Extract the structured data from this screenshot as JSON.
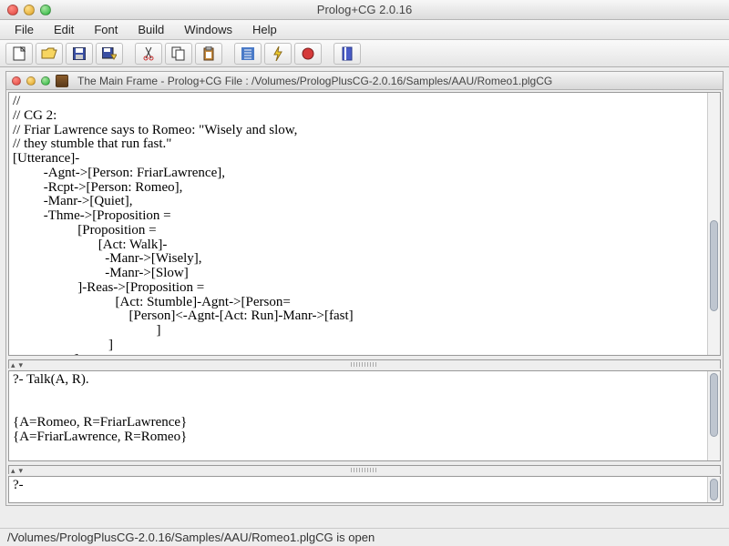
{
  "window": {
    "title": "Prolog+CG 2.0.16"
  },
  "menu": {
    "items": [
      "File",
      "Edit",
      "Font",
      "Build",
      "Windows",
      "Help"
    ]
  },
  "subwindow": {
    "title": "The Main Frame - Prolog+CG File : /Volumes/PrologPlusCG-2.0.16/Samples/AAU/Romeo1.plgCG"
  },
  "editor": {
    "content": "//\n// CG 2:\n// Friar Lawrence says to Romeo: \"Wisely and slow,\n// they stumble that run fast.\"\n[Utterance]-\n         -Agnt->[Person: FriarLawrence],\n         -Rcpt->[Person: Romeo],\n         -Manr->[Quiet],\n         -Thme->[Proposition =\n                   [Proposition =\n                         [Act: Walk]-\n                           -Manr->[Wisely],\n                           -Manr->[Slow]\n                   ]-Reas->[Proposition =\n                              [Act: Stumble]-Agnt->[Person=\n                                  [Person]<-Agnt-[Act: Run]-Manr->[fast]\n                                          ]\n                            ]\n                  ]"
  },
  "console": {
    "content": "?- Talk(A, R).\n\n\n{A=Romeo, R=FriarLawrence}\n{A=FriarLawrence, R=Romeo}"
  },
  "input": {
    "content": "?-"
  },
  "status": {
    "text": "/Volumes/PrologPlusCG-2.0.16/Samples/AAU/Romeo1.plgCG is open"
  }
}
